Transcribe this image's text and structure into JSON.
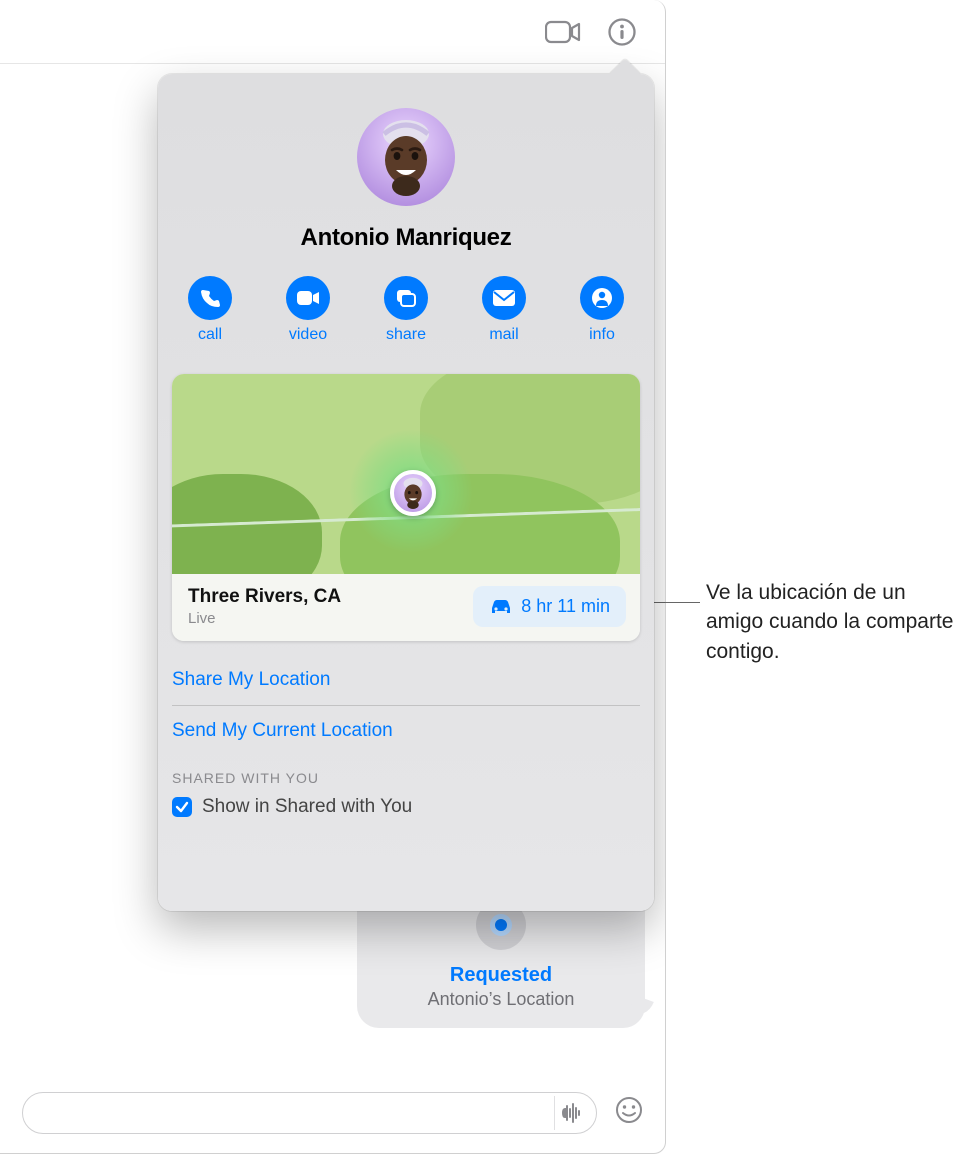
{
  "toolbar": {
    "video_icon": "video-icon",
    "info_icon": "info-icon"
  },
  "contact": {
    "name": "Antonio Manriquez"
  },
  "actions": {
    "call_label": "call",
    "video_label": "video",
    "share_label": "share",
    "mail_label": "mail",
    "info_label": "info"
  },
  "location": {
    "place": "Three Rivers, CA",
    "status": "Live",
    "drive_time": "8 hr 11 min"
  },
  "links": {
    "share_location": "Share My Location",
    "send_current": "Send My Current Location"
  },
  "section": {
    "shared_with_you": "SHARED WITH YOU",
    "show_in_shared": "Show in Shared with You"
  },
  "bubble": {
    "title": "Requested",
    "subtitle": "Antonio’s Location"
  },
  "callout": {
    "text": "Ve la ubicación de un amigo cuando la comparte contigo."
  }
}
